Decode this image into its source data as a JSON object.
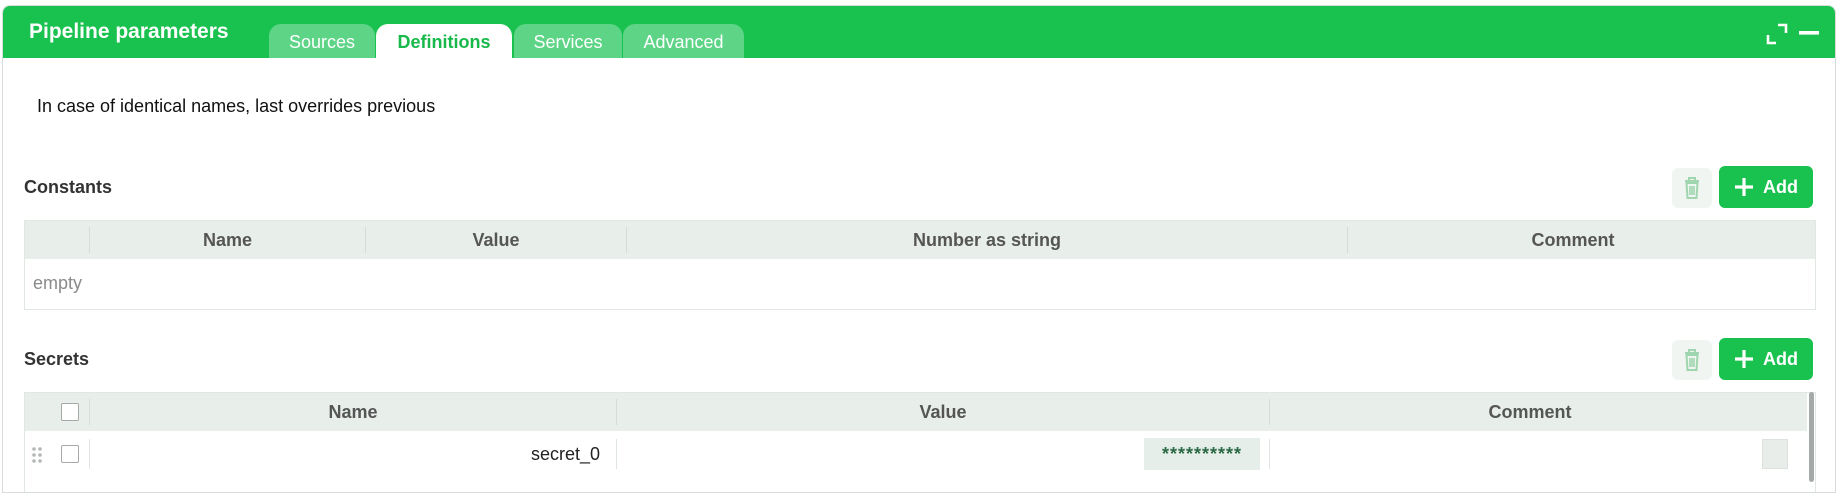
{
  "panel": {
    "title": "Pipeline parameters",
    "tabs": [
      {
        "label": "Sources",
        "active": false
      },
      {
        "label": "Definitions",
        "active": true
      },
      {
        "label": "Services",
        "active": false
      },
      {
        "label": "Advanced",
        "active": false
      }
    ],
    "header_icons": [
      "expand-icon",
      "minimize-icon"
    ],
    "accent_color": "#19c24e"
  },
  "info_text": "In case of identical names, last overrides previous",
  "constants": {
    "title": "Constants",
    "add_label": "Add",
    "columns": [
      "Name",
      "Value",
      "Number as string",
      "Comment"
    ],
    "empty_text": "empty",
    "rows": []
  },
  "secrets": {
    "title": "Secrets",
    "add_label": "Add",
    "columns": [
      "Name",
      "Value",
      "Comment"
    ],
    "rows": [
      {
        "name": "secret_0",
        "value": "**********",
        "comment": ""
      }
    ]
  }
}
